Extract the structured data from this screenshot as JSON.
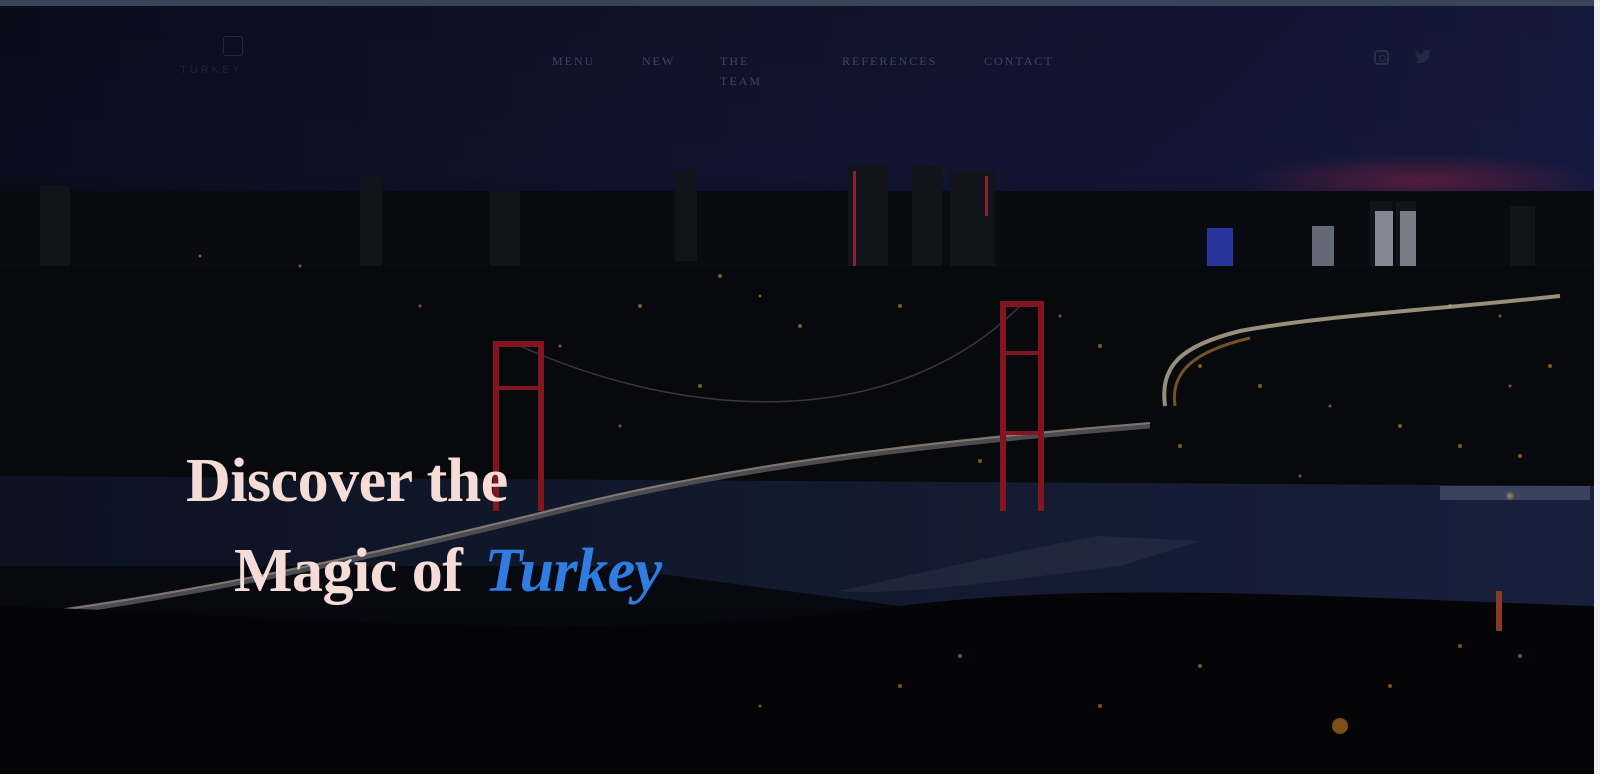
{
  "brand": {
    "name": "TURKEY"
  },
  "nav": {
    "items": [
      {
        "label": "MENU"
      },
      {
        "label": "NEW"
      },
      {
        "label": "THE TEAM"
      },
      {
        "label": "REFERENCES"
      },
      {
        "label": "CONTACT"
      }
    ]
  },
  "social": {
    "icons": [
      "instagram-icon",
      "twitter-icon"
    ]
  },
  "hero": {
    "line1": "Discover the",
    "line2": "Magic of",
    "accent": "Turkey"
  },
  "colors": {
    "headline": "#f6dcd6",
    "accent": "#2f7de0",
    "bridge": "#c01e2c",
    "night_sky": "#141836"
  }
}
